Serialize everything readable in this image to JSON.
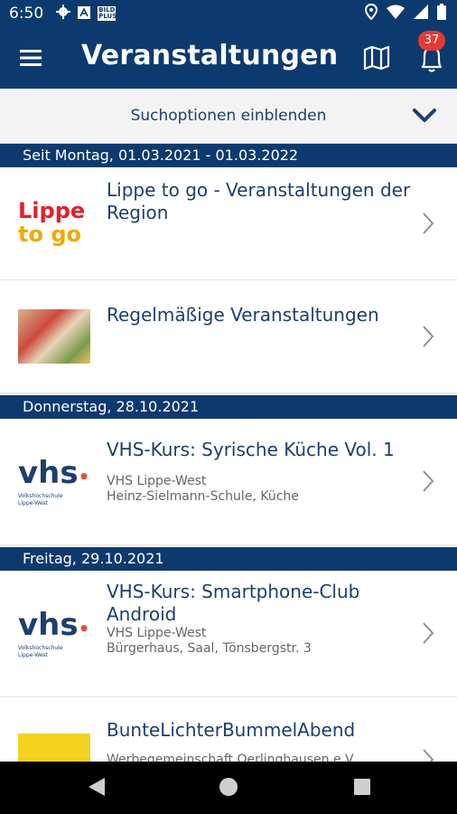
{
  "status_bar": {
    "time": "6:50",
    "icons": [
      "gear-icon",
      "a-icon",
      "bildplus-icon",
      "location-icon",
      "wifi-icon",
      "signal-icon",
      "battery-icon"
    ],
    "bildplus_text": "BILD PLUS"
  },
  "app_bar": {
    "title": "Veranstaltungen",
    "notification_count": "37",
    "colors": {
      "primary": "#0d3a6e",
      "badge": "#e53935"
    }
  },
  "search": {
    "label": "Suchoptionen einblenden"
  },
  "sections": [
    {
      "header": "Seit Montag, 01.03.2021 - 01.03.2022",
      "items": [
        {
          "title": "Lippe to go - Veranstaltungen der Region",
          "thumb": "lippe-to-go-logo",
          "logo_line1": "Lippe",
          "logo_line2": "to go"
        },
        {
          "title": "Regelmäßige Veranstaltungen",
          "thumb": "event-photo"
        }
      ]
    },
    {
      "header": "Donnerstag, 28.10.2021",
      "items": [
        {
          "title": "VHS-Kurs: Syrische Küche Vol. 1",
          "thumb": "vhs-logo",
          "organizer": "VHS Lippe-West",
          "location": "Heinz-Sielmann-Schule, Küche",
          "logo_text": "vhs",
          "logo_sub1": "Volkshochschule",
          "logo_sub2": "Lippe-West"
        }
      ]
    },
    {
      "header": "Freitag, 29.10.2021",
      "items": [
        {
          "title": "VHS-Kurs: Smartphone-Club Android",
          "thumb": "vhs-logo",
          "organizer": "VHS Lippe-West",
          "location": "Bürgerhaus, Saal, Tönsbergstr. 3",
          "logo_text": "vhs",
          "logo_sub1": "Volkshochschule",
          "logo_sub2": "Lippe-West"
        },
        {
          "title": "BunteLichterBummelAbend",
          "thumb": "yellow-banner",
          "organizer": "Werbegemeinschaft Oerlinghausen e.V."
        }
      ]
    }
  ]
}
